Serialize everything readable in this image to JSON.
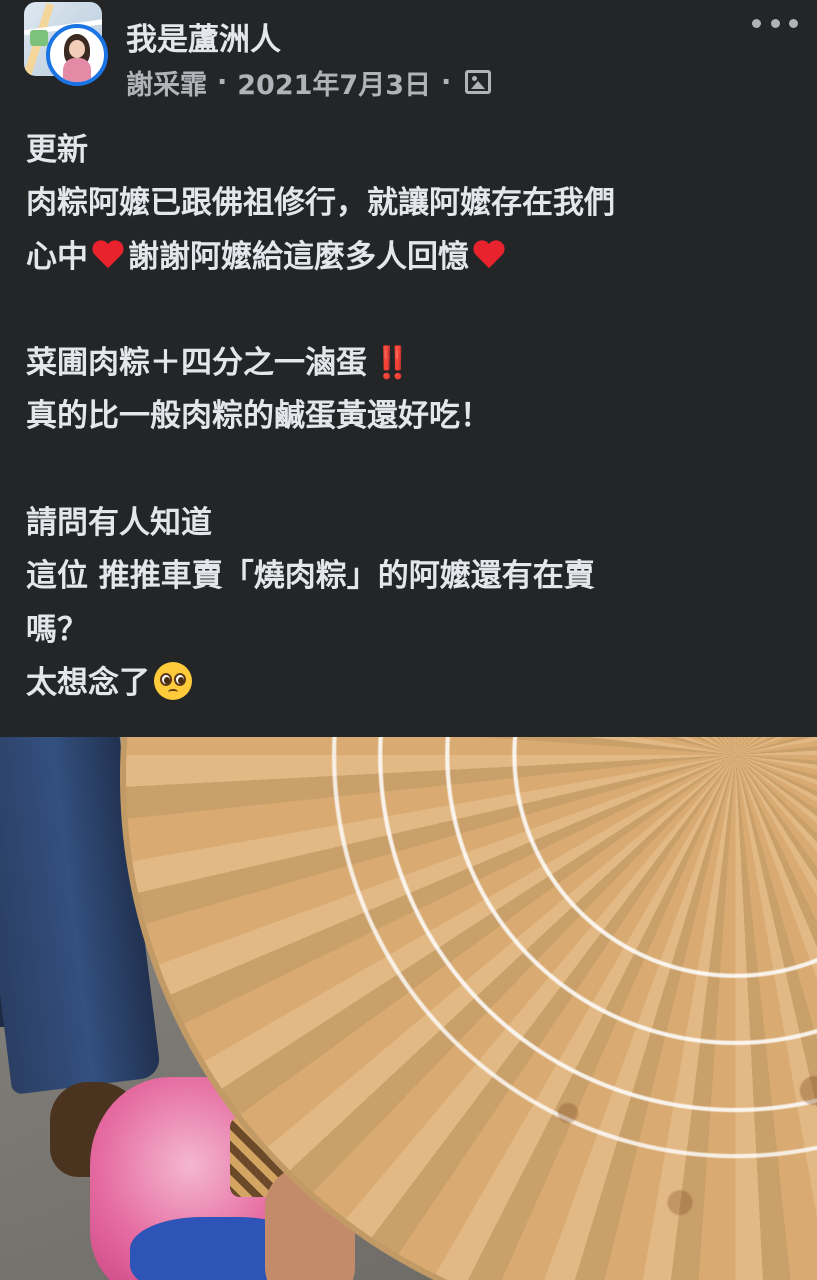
{
  "post": {
    "group_name": "我是蘆洲人",
    "author": "謝采霏",
    "separator": "·",
    "date": "2021年7月3日",
    "privacy_icon": "photo-icon",
    "more_icon": "more-horizontal-icon",
    "text_lines": {
      "l1": "更新",
      "l2": "肉粽阿嬤已跟佛祖修行，就讓阿嬤存在我們",
      "l3a": "心中",
      "l3b": "謝謝阿嬤給這麼多人回憶",
      "l5": "菜圃肉粽＋四分之一滷蛋",
      "l5_emoji": "‼️",
      "l6": "真的比一般肉粽的鹹蛋黃還好吃！",
      "l8": "請問有人知道",
      "l9": "這位 推推車賣「燒肉粽」的阿嬤還有在賣",
      "l10": "嗎？",
      "l11": "太想念了"
    },
    "emojis": [
      "heart-emoji",
      "double-exclamation-emoji",
      "pleading-face-emoji"
    ]
  },
  "colors": {
    "background": "#242526",
    "primary_text": "#e4e6eb",
    "secondary_text": "#b0b3b8",
    "avatar_ring": "#1b74e4",
    "heart": "#e8232e"
  }
}
